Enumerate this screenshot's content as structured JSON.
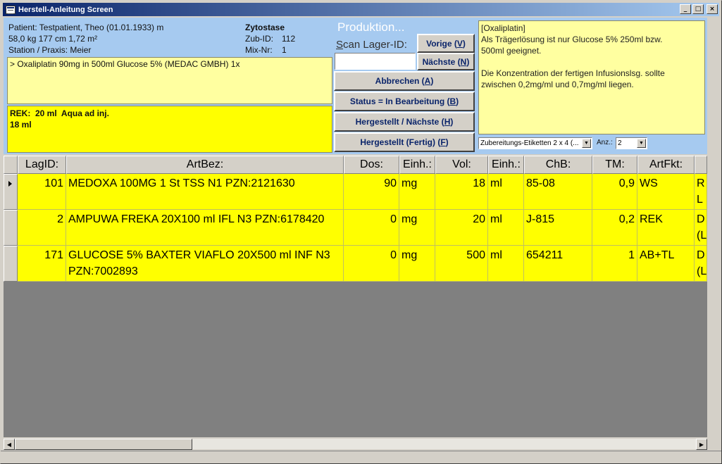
{
  "window": {
    "title": "Herstell-Anleitung Screen",
    "controls": {
      "minimize": "_",
      "maximize": "□",
      "close": "×"
    }
  },
  "patient": {
    "line1": "Patient: Testpatient, Theo (01.01.1933) m",
    "line2": "58,0 kg  177 cm  1,72 m²",
    "line3": "Station / Praxis: Meier"
  },
  "zytostase": {
    "title": "Zytostase",
    "zub_label": "Zub-ID:",
    "zub_value": "112",
    "mix_label": "Mix-Nr:",
    "mix_value": "1"
  },
  "order_text": "> Oxaliplatin 90mg in 500ml Glucose 5% (MEDAC GMBH) 1x",
  "rek_text": "REK:  20 ml  Aqua ad inj.\n18 ml",
  "produktion": {
    "title": "Produktion...",
    "scan_label_first": "S",
    "scan_label_rest": "can Lager-ID:",
    "scan_value": ""
  },
  "buttons": {
    "vorige": "Vorige (",
    "vorige_key": "V",
    "naechste": "Nächste (",
    "naechste_key": "N",
    "abbrechen": "Abbrechen (",
    "abbrechen_key": "A",
    "status": "Status = In Bearbeitung (",
    "status_key": "B",
    "hergestellt_naechste": "Hergestellt / Nächste (",
    "hergestellt_naechste_key": "H",
    "hergestellt_fertig": "Hergestellt (Fertig) (",
    "hergestellt_fertig_key": "F",
    "close_paren": ")"
  },
  "note_text": "[Oxaliplatin]\nAls Trägerlösung ist nur Glucose 5% 250ml bzw.\n500ml geeignet.\n\nDie Konzentration der fertigen Infusionslsg. sollte\nzwischen 0,2mg/ml und 0,7mg/ml liegen.",
  "etiketten": {
    "value": "Zubereitungs-Etiketten 2 x 4 (...",
    "anz_label": "Anz.:",
    "anz_value": "2"
  },
  "table": {
    "columns": [
      "LagID:",
      "ArtBez:",
      "Dos:",
      "Einh.:",
      "Vol:",
      "Einh.:",
      "ChB:",
      "TM:",
      "ArtFkt:",
      ""
    ],
    "rows": [
      {
        "lagid": "101",
        "artbez": "MEDOXA 100MG   1 St TSS N1 PZN:2121630",
        "dos": "90",
        "einh1": "mg",
        "vol": "18",
        "einh2": "ml",
        "chb": "85-08",
        "tm": "0,9",
        "artfkt": "WS",
        "extra": "R\nL"
      },
      {
        "lagid": "2",
        "artbez": "AMPUWA FREKA   20X100 ml IFL N3 PZN:6178420",
        "dos": "0",
        "einh1": "mg",
        "vol": "20",
        "einh2": "ml",
        "chb": "J-815",
        "tm": "0,2",
        "artfkt": "REK",
        "extra": "D\n(L"
      },
      {
        "lagid": "171",
        "artbez": "GLUCOSE 5% BAXTER VIAFLO   20X500 ml INF N3 PZN:7002893",
        "dos": "0",
        "einh1": "mg",
        "vol": "500",
        "einh2": "ml",
        "chb": "654211",
        "tm": "1",
        "artfkt": "AB+TL",
        "extra": "D\n(L"
      }
    ]
  },
  "colors": {
    "header_bg": "#a6caf0",
    "note_bg": "#ffffa0",
    "rek_bg": "#ffff00",
    "row_bg": "#ffff00",
    "button_text": "#0a246a"
  }
}
